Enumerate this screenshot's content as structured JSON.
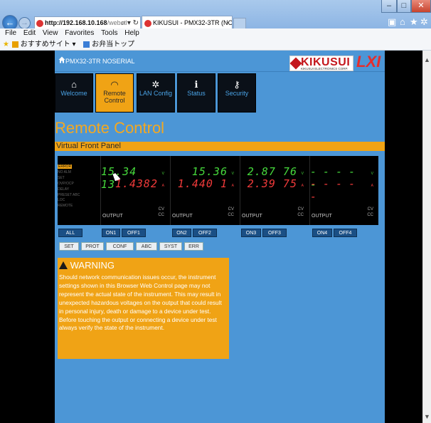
{
  "browser": {
    "address": {
      "host": "http://192.168.10.168",
      "path": "/webctl",
      "controls": "⌕ ▾ ↻"
    },
    "tab": {
      "title": "KIKUSUI - PMX32-3TR (NOS...",
      "close": "×"
    },
    "menu": [
      "File",
      "Edit",
      "View",
      "Favorites",
      "Tools",
      "Help"
    ],
    "favorites": [
      "おすすめサイト ▾",
      "お弁当トップ"
    ],
    "window_controls": {
      "min": "–",
      "max": "□",
      "close": "✕"
    }
  },
  "header": {
    "title": "PMX32-3TR NOSERIAL",
    "logo": {
      "name": "KIKUSUI",
      "corp": "KIKUSUI ELECTRONICS CORP.",
      "lxi": "LXI"
    }
  },
  "nav": [
    {
      "label": "Welcome",
      "icon": "home-icon",
      "glyph": "⌂"
    },
    {
      "label": "Remote Control",
      "icon": "gauge-icon",
      "glyph": "◠",
      "active": true
    },
    {
      "label": "LAN Config",
      "icon": "gear-icon",
      "glyph": "✲"
    },
    {
      "label": "Status",
      "icon": "info-icon",
      "glyph": "ℹ"
    },
    {
      "label": "Security",
      "icon": "key-icon",
      "glyph": "⚷"
    }
  ],
  "page": {
    "title": "Remote Control",
    "section": "Virtual Front Panel"
  },
  "status_list": [
    "ERROR",
    "NO ALM",
    "SET",
    "OVP/OCP",
    "DELAY",
    "PRESET ABC",
    "LOC",
    "REMOTE"
  ],
  "channels": [
    {
      "voltage": "15.34 13",
      "v_unit": "V",
      "current": "1.4382",
      "a_unit": "A",
      "cv": "CV",
      "cc": "CC",
      "output": "OUTPUT"
    },
    {
      "voltage": "15.36",
      "v_unit": "V",
      "current": "1.440 1",
      "a_unit": "A",
      "cv": "CV",
      "cc": "CC",
      "output": "OUTPUT"
    },
    {
      "voltage": "2.87 76",
      "v_unit": "V",
      "current": "2.39 75",
      "a_unit": "A",
      "cv": "CV",
      "cc": "CC",
      "output": "OUTPUT"
    },
    {
      "voltage": "- - - - -",
      "v_unit": "V",
      "current": "- - - - -",
      "a_unit": "A",
      "cv": "CV",
      "cc": "CC",
      "output": "OUTPUT"
    }
  ],
  "buttons": {
    "all": "ALL",
    "on1": "ON1",
    "off1": "OFF1",
    "on2": "ON2",
    "off2": "OFF2",
    "on3": "ON3",
    "off3": "OFF3",
    "on4": "ON4",
    "off4": "OFF4",
    "set": "SET",
    "prot": "PROT",
    "conf": "CONF",
    "abc": "ABC",
    "syst": "SYST",
    "err": "ERR"
  },
  "warning": {
    "title": "WARNING",
    "text": "Should network communication issues occur, the instrument settings shown in this Browser Web Control page may not represent the actual state of the instrument. This may result in unexpected hazardous voltages on the output that could result in personal injury, death or damage to a device under test. Before touching the output or connecting a device under test always verify the state of the instrument."
  },
  "colors": {
    "accent": "#f0a315",
    "page_bg": "#4c96d6",
    "voltage_green": "#46d83c",
    "current_red": "#f03a3a"
  }
}
